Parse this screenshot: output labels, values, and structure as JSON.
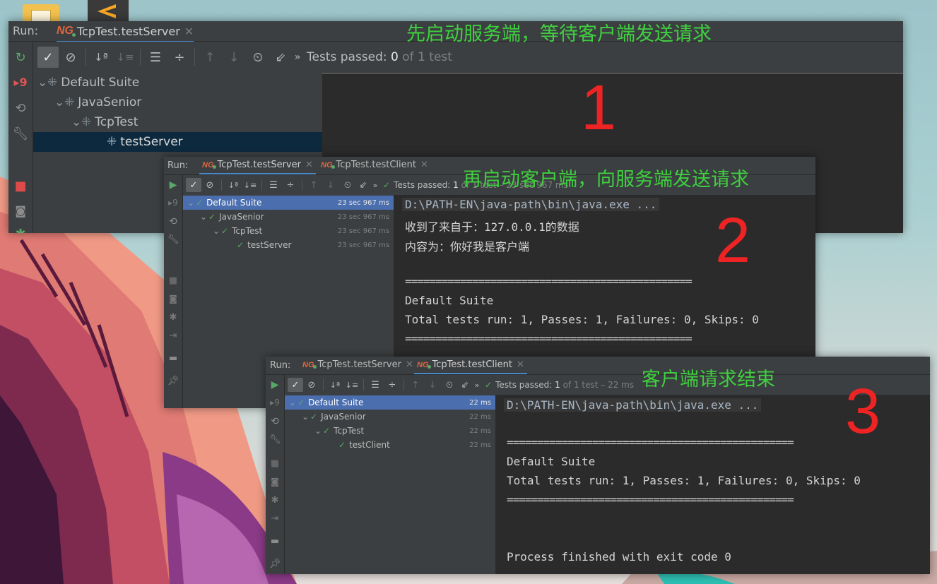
{
  "win1": {
    "run_label": "Run:",
    "tab_label": "TcpTest.testServer",
    "status_prefix": "Tests passed:",
    "status_count": "0",
    "status_suffix": "of 1 test",
    "tree": [
      "Default Suite",
      "JavaSenior",
      "TcpTest",
      "testServer"
    ],
    "annotation": "先启动服务端，等待客户端发送请求",
    "step": "1"
  },
  "win2": {
    "run_label": "Run:",
    "tabs": [
      "TcpTest.testServer",
      "TcpTest.testClient"
    ],
    "status_prefix": "Tests passed:",
    "status_count": "1",
    "status_suffix": "of 1 test – 23 sec 967 ms",
    "tree": [
      {
        "label": "Default Suite",
        "dur": "23 sec 967 ms"
      },
      {
        "label": "JavaSenior",
        "dur": "23 sec 967 ms"
      },
      {
        "label": "TcpTest",
        "dur": "23 sec 967 ms"
      },
      {
        "label": "testServer",
        "dur": "23 sec 967 ms"
      }
    ],
    "console": [
      "D:\\PATH-EN\\java-path\\bin\\java.exe ...",
      "收到了来自于：127.0.0.1的数据",
      "内容为：你好我是客户端",
      "",
      "===============================================",
      "Default Suite",
      "Total tests run: 1, Passes: 1, Failures: 0, Skips: 0",
      "==============================================="
    ],
    "annotation": "再启动客户端，向服务端发送请求",
    "step": "2"
  },
  "win3": {
    "run_label": "Run:",
    "tabs": [
      "TcpTest.testServer",
      "TcpTest.testClient"
    ],
    "status_prefix": "Tests passed:",
    "status_count": "1",
    "status_suffix": "of 1 test – 22 ms",
    "tree": [
      {
        "label": "Default Suite",
        "dur": "22 ms"
      },
      {
        "label": "JavaSenior",
        "dur": "22 ms"
      },
      {
        "label": "TcpTest",
        "dur": "22 ms"
      },
      {
        "label": "testClient",
        "dur": "22 ms"
      }
    ],
    "console": [
      "D:\\PATH-EN\\java-path\\bin\\java.exe ...",
      "",
      "===============================================",
      "Default Suite",
      "Total tests run: 1, Passes: 1, Failures: 0, Skips: 0",
      "===============================================",
      "",
      "",
      "Process finished with exit code 0"
    ],
    "annotation": "客户端请求结束",
    "step": "3"
  },
  "colors": {
    "annotation": "#3fcf3f",
    "step_number": "#ee2424",
    "pass_check": "#59a869",
    "selection": "#4b6eaf"
  }
}
